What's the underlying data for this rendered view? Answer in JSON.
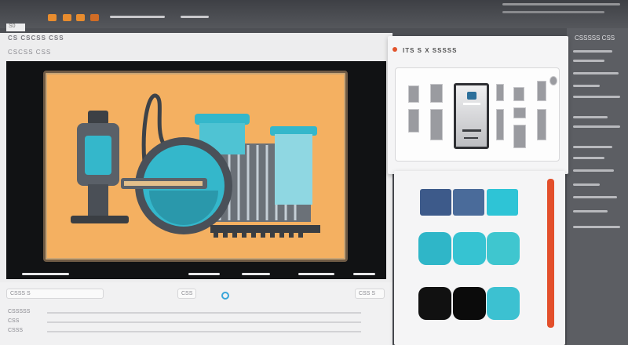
{
  "window": {
    "title": "CS  CSCSS  CSS",
    "menu": "CSCSS    CSS",
    "tab_label": "S0"
  },
  "assets_panel": {
    "title": "ITS  S X  SSSSS",
    "thumbnails": 12
  },
  "controls": {
    "field_1": "CSSS  S",
    "field_2": "CSS",
    "field_3": "CSS  S",
    "row_1": "CSSSSS",
    "row_2": "CSS",
    "row_3": "CSSS"
  },
  "right_panel": {
    "header": "CSSSSS CSS",
    "lines": [
      "CS CSS",
      "CSSS",
      "CS"
    ]
  },
  "swatches": {
    "row1": [
      "#3d5a8a",
      "#4a6b9a",
      "#2ec4d6"
    ],
    "row2": [
      "#2fb6c8",
      "#36c3d2",
      "#3fc6cf"
    ],
    "row3": [
      "#111111",
      "#0b0b0b",
      "#3cc1d1"
    ]
  },
  "colors": {
    "accent_orange": "#e34f2b",
    "artwork_bg": "#f4b061",
    "teal": "#32b8cc"
  }
}
